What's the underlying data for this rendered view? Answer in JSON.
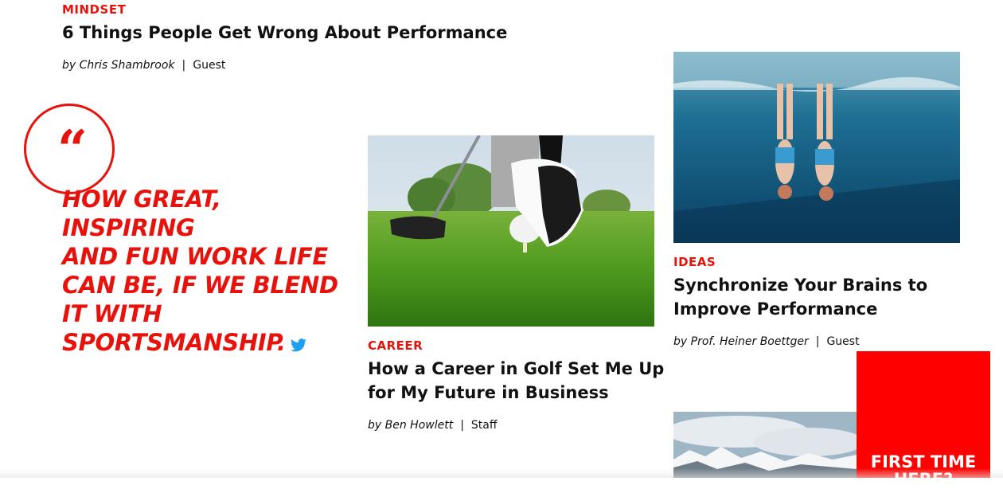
{
  "articles": {
    "top": {
      "category": "MINDSET",
      "title": "6 Things People Get Wrong About Performance",
      "author": "by Chris Shambrook",
      "separator": "|",
      "role": "Guest"
    },
    "golf": {
      "category": "CAREER",
      "title_line1": "How a Career in Golf Set Me Up",
      "title_line2": "for My Future in Business",
      "author": "by Ben Howlett",
      "separator": "|",
      "role": "Staff"
    },
    "swim": {
      "category": "IDEAS",
      "title_line1": "Synchronize Your Brains to",
      "title_line2": "Improve Performance",
      "author": "by Prof. Heiner Boettger",
      "separator": "|",
      "role": "Guest"
    }
  },
  "quote": {
    "mark": "“",
    "line1": "HOW GREAT, INSPIRING",
    "line2": "AND FUN WORK LIFE",
    "line3": "CAN BE, IF WE BLEND",
    "line4": "IT WITH",
    "line5": "SPORTSMANSHIP."
  },
  "cta": {
    "line1": "FIRST TIME",
    "line2": "HERE?"
  },
  "colors": {
    "accent": "#e8120c",
    "cta_bg": "#ff0000",
    "twitter": "#1da1f2"
  },
  "icons": {
    "quote": "quote-mark-icon",
    "twitter": "twitter-icon"
  }
}
